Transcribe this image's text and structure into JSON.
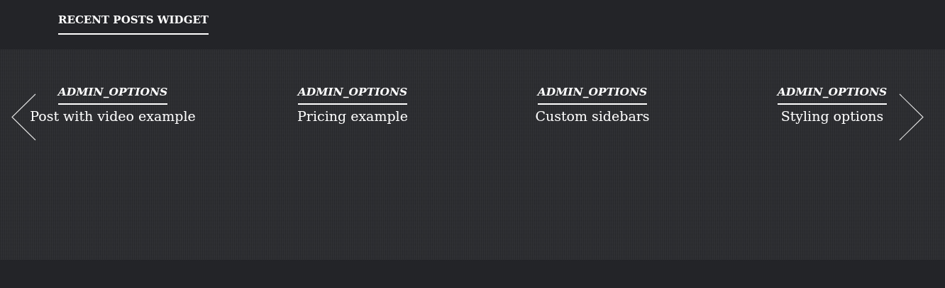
{
  "widget": {
    "title": "RECENT POSTS WIDGET"
  },
  "posts": [
    {
      "author": "ADMIN_OPTIONS",
      "title": "Post with video example"
    },
    {
      "author": "ADMIN_OPTIONS",
      "title": "Pricing example"
    },
    {
      "author": "ADMIN_OPTIONS",
      "title": "Custom sidebars"
    },
    {
      "author": "ADMIN_OPTIONS",
      "title": "Styling options"
    }
  ]
}
